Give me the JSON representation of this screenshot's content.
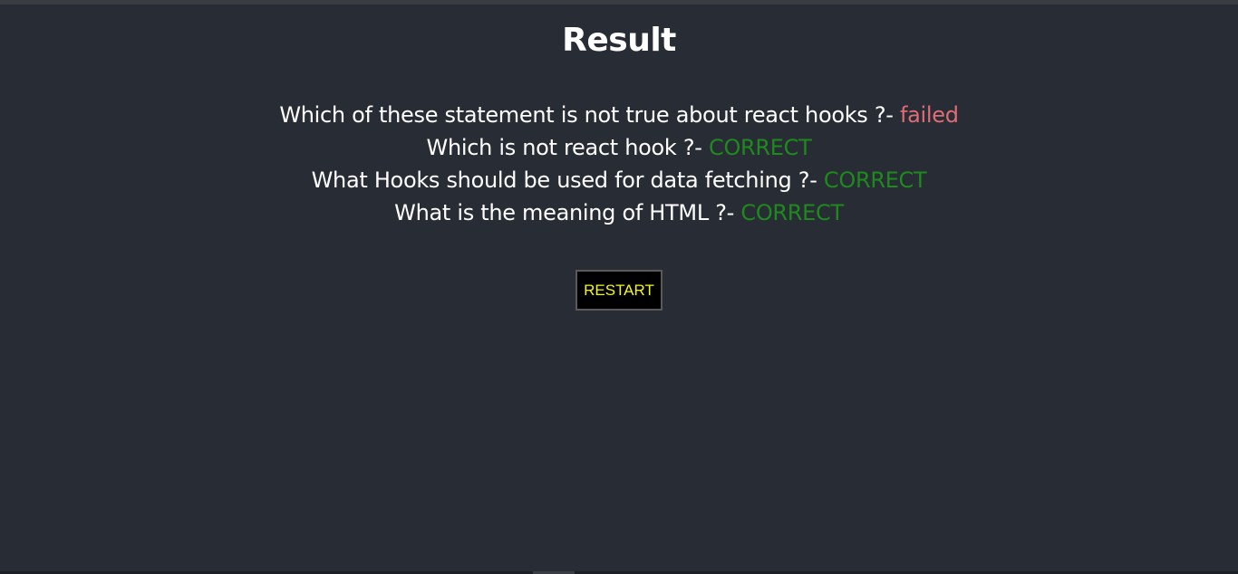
{
  "title": "Result",
  "results": [
    {
      "question": "Which of these statement is not true about react hooks ?- ",
      "status": "failed"
    },
    {
      "question": "Which is not react hook ?- ",
      "status": "CORRECT"
    },
    {
      "question": "What Hooks should be used for data fetching ?- ",
      "status": "CORRECT"
    },
    {
      "question": "What is the meaning of HTML ?- ",
      "status": "CORRECT"
    }
  ],
  "restart_label": "RESTART",
  "colors": {
    "background": "#282c34",
    "text": "#ffffff",
    "failed": "#e06c75",
    "correct": "#1e8a1e",
    "button_bg": "#000000",
    "button_text": "#f5f51e"
  }
}
